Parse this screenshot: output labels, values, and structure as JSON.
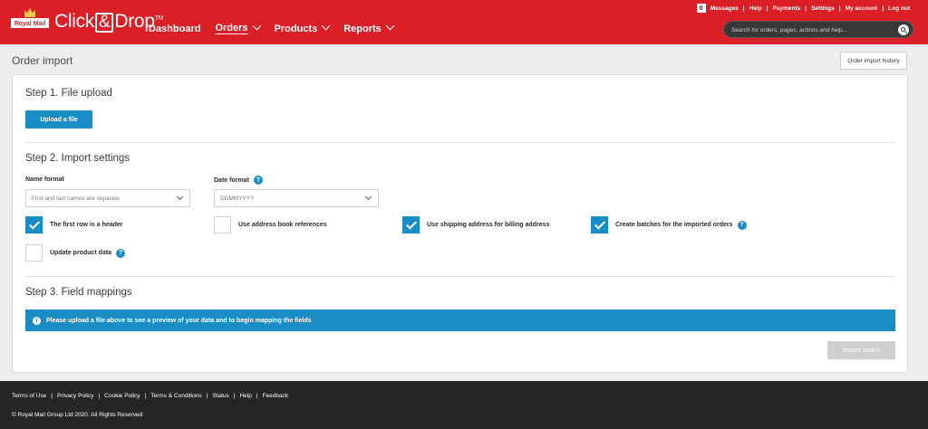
{
  "header": {
    "logo_label": "Royal Mail",
    "app_name_left": "Click",
    "app_name_amp": "&",
    "app_name_right": "Drop",
    "trademark": "TM",
    "nav": [
      {
        "label": "Dashboard",
        "dropdown": false,
        "active": false
      },
      {
        "label": "Orders",
        "dropdown": true,
        "active": true
      },
      {
        "label": "Products",
        "dropdown": true,
        "active": false
      },
      {
        "label": "Reports",
        "dropdown": true,
        "active": false
      }
    ],
    "messages_count": "0",
    "top_links": [
      "Messages",
      "Help",
      "Payments",
      "Settings",
      "My account",
      "Log out"
    ],
    "search_placeholder": "Search for orders, pages, actions and help..."
  },
  "page": {
    "title": "Order import",
    "history_button": "Order import history"
  },
  "step1": {
    "title": "Step 1. File upload",
    "upload_button": "Upload a file"
  },
  "step2": {
    "title": "Step 2. Import settings",
    "name_format_label": "Name format",
    "name_format_value": "First and last names are separate",
    "date_format_label": "Date format",
    "date_format_value": "DDMMYYYY",
    "options": [
      {
        "label": "The first row is a header",
        "checked": true,
        "help": false
      },
      {
        "label": "Use address book references",
        "checked": false,
        "help": false
      },
      {
        "label": "Use shipping address for billing address",
        "checked": true,
        "help": false
      },
      {
        "label": "Create batches for the imported orders",
        "checked": true,
        "help": true
      },
      {
        "label": "Update product data",
        "checked": false,
        "help": true
      }
    ]
  },
  "step3": {
    "title": "Step 3. Field mappings",
    "info": "Please upload a file above to see a preview of your data and to begin mapping the fields",
    "import_button": "Import orders"
  },
  "footer": {
    "links": [
      "Terms of Use",
      "Privacy Policy",
      "Cookie Policy",
      "Terms & Conditions",
      "Status",
      "Help",
      "Feedback"
    ],
    "copyright": "© Royal Mail Group Ltd 2020. All Rights Reserved"
  },
  "colors": {
    "brand_red": "#da1f26",
    "accent_blue": "#1a8dc5",
    "footer_bg": "#262626"
  }
}
